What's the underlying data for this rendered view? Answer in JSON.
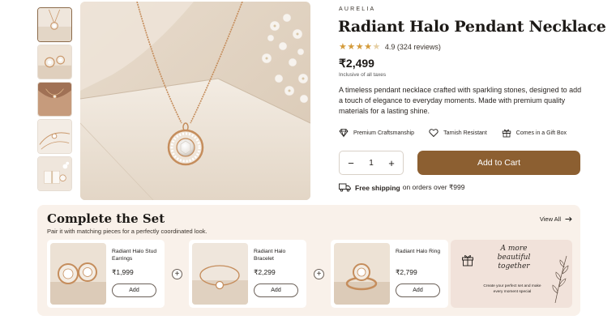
{
  "brand": "AURELIA",
  "product": {
    "title": "Radiant Halo Pendant Necklace",
    "rating_value": 4.5,
    "rating_text": "4.9 (324 reviews)",
    "price": "₹2,499",
    "tax_note": "Inclusive of all taxes",
    "description": "A timeless pendant necklace crafted with sparkling stones, designed to add a touch of elegance to everyday moments. Made with premium quality materials for a lasting shine."
  },
  "features": [
    {
      "icon": "diamond-icon",
      "label": "Premium Craftsmanship"
    },
    {
      "icon": "heart-icon",
      "label": "Tarnish Resistant"
    },
    {
      "icon": "gift-icon",
      "label": "Comes in a Gift Box"
    }
  ],
  "quantity": {
    "value": "1",
    "minus": "−",
    "plus": "+"
  },
  "add_to_cart_label": "Add to Cart",
  "shipping": {
    "bold": "Free shipping",
    "rest": "on orders over ₹999"
  },
  "gallery": {
    "thumbnails": [
      "pendant-thumb",
      "earrings-thumb",
      "model-thumb",
      "chain-thumb",
      "gift-box-thumb"
    ],
    "active_index": 0
  },
  "set_section": {
    "title": "Complete the Set",
    "subtitle": "Pair it with matching pieces for a perfectly coordinated look.",
    "view_all": "View All",
    "items": [
      {
        "name": "Radiant Halo Stud Earrings",
        "price": "₹1,999",
        "add": "Add"
      },
      {
        "name": "Radiant Halo Bracelet",
        "price": "₹2,299",
        "add": "Add"
      },
      {
        "name": "Radiant Halo Ring",
        "price": "₹2,799",
        "add": "Add"
      }
    ],
    "plus_symbol": "+",
    "promo": {
      "headline": "A more beautiful together",
      "text": "Create your perfect set and make every moment special"
    }
  },
  "colors": {
    "accent": "#8c5f31",
    "star": "#d49b3a",
    "section_bg": "#f9f1ea",
    "promo_bg": "#f1e2da"
  }
}
